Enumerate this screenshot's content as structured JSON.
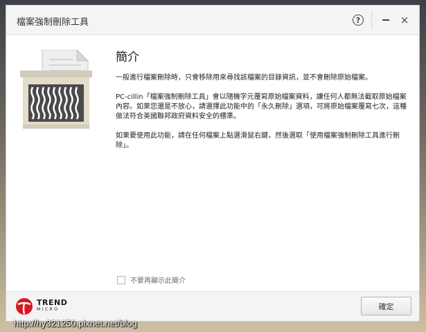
{
  "window": {
    "title": "檔案強制刪除工具"
  },
  "titlebar": {
    "help_label": "?",
    "close_label": "×"
  },
  "icons": {
    "help": "help-circle-icon",
    "minimize": "minimize-icon",
    "close": "close-icon",
    "shredder": "shredder-icon",
    "brand": "trend-micro-logo-icon"
  },
  "content": {
    "heading": "簡介",
    "paragraphs": [
      "一般進行檔案刪除時，只會移除用來尋找該檔案的目錄資訊，並不會刪除原始檔案。",
      "PC-cillin「檔案強制刪除工具」會以隨機字元覆寫原始檔案資料，讓任何人都無法截取原始檔案內容。如果您還是不放心，請選擇此功能中的「永久刪除」選項，可將原始檔案覆寫七次，這種做法符合美國聯邦政府資料安全的標準。",
      "如果要使用此功能，請在任何檔案上點選滑鼠右鍵，然後選取「使用檔案強制刪除工具進行刪除」。"
    ]
  },
  "options": {
    "dont_show_label": "不要再顯示此簡介",
    "dont_show_checked": false
  },
  "footer": {
    "ok_label": "確定",
    "brand_name": "TREND",
    "brand_sub": "MICRO"
  },
  "watermark": "http://hy321250.pixnet.net/blog",
  "colors": {
    "brand_red": "#d71920",
    "window_bg": "#ffffff",
    "bar_bg": "#f4f4f4"
  }
}
